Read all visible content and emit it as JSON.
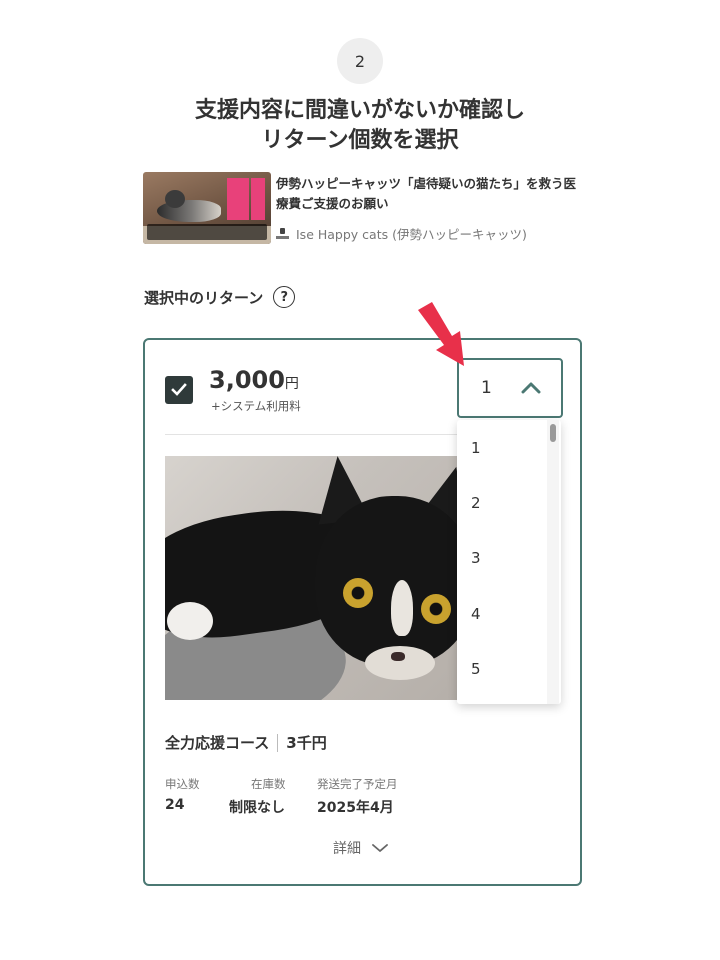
{
  "step": {
    "number": "2"
  },
  "headline": {
    "line1": "支援内容に間違いがないか確認し",
    "line2": "リターン個数を選択"
  },
  "project": {
    "title": "伊勢ハッピーキャッツ「虐待疑いの猫たち」を救う医療費ご支援のお願い",
    "owner": "Ise Happy cats (伊勢ハッピーキャッツ)"
  },
  "section": {
    "label": "選択中のリターン",
    "help_icon": "question-circle-icon"
  },
  "reward": {
    "price": "3,000",
    "currency": "円",
    "fee_note": "+システム利用料",
    "checked": true,
    "selected_quantity": "1",
    "quantity_options": [
      "1",
      "2",
      "3",
      "4",
      "5"
    ],
    "course_title": "全力応援コース",
    "course_price": "3千円",
    "meta": {
      "applications_label": "申込数",
      "applications_value": "24",
      "stock_label": "在庫数",
      "stock_value": "制限なし",
      "delivery_label": "発送完了予定月",
      "delivery_value": "2025年4月"
    },
    "details_label": "詳細"
  },
  "colors": {
    "accent": "#4b7873",
    "arrow": "#e8304a",
    "checkbox": "#2f3a3a"
  }
}
